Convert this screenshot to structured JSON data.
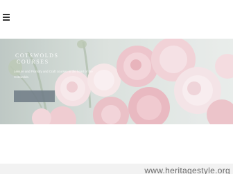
{
  "header": {
    "menu_icon": "hamburger-menu-icon"
  },
  "hero": {
    "brand_line1": "COTSWOLDS",
    "brand_line2": "COURSES",
    "tagline": "Leisure and Floristry and Craft courses in the heart of the Cotswolds.",
    "cta_label": ""
  },
  "footer": {
    "domain": "www.heritagestyle.org"
  },
  "colors": {
    "hero_bg": "#c7d1cc",
    "cta_bg": "#6f7b86",
    "flower_pink": "#e8b4bc"
  }
}
